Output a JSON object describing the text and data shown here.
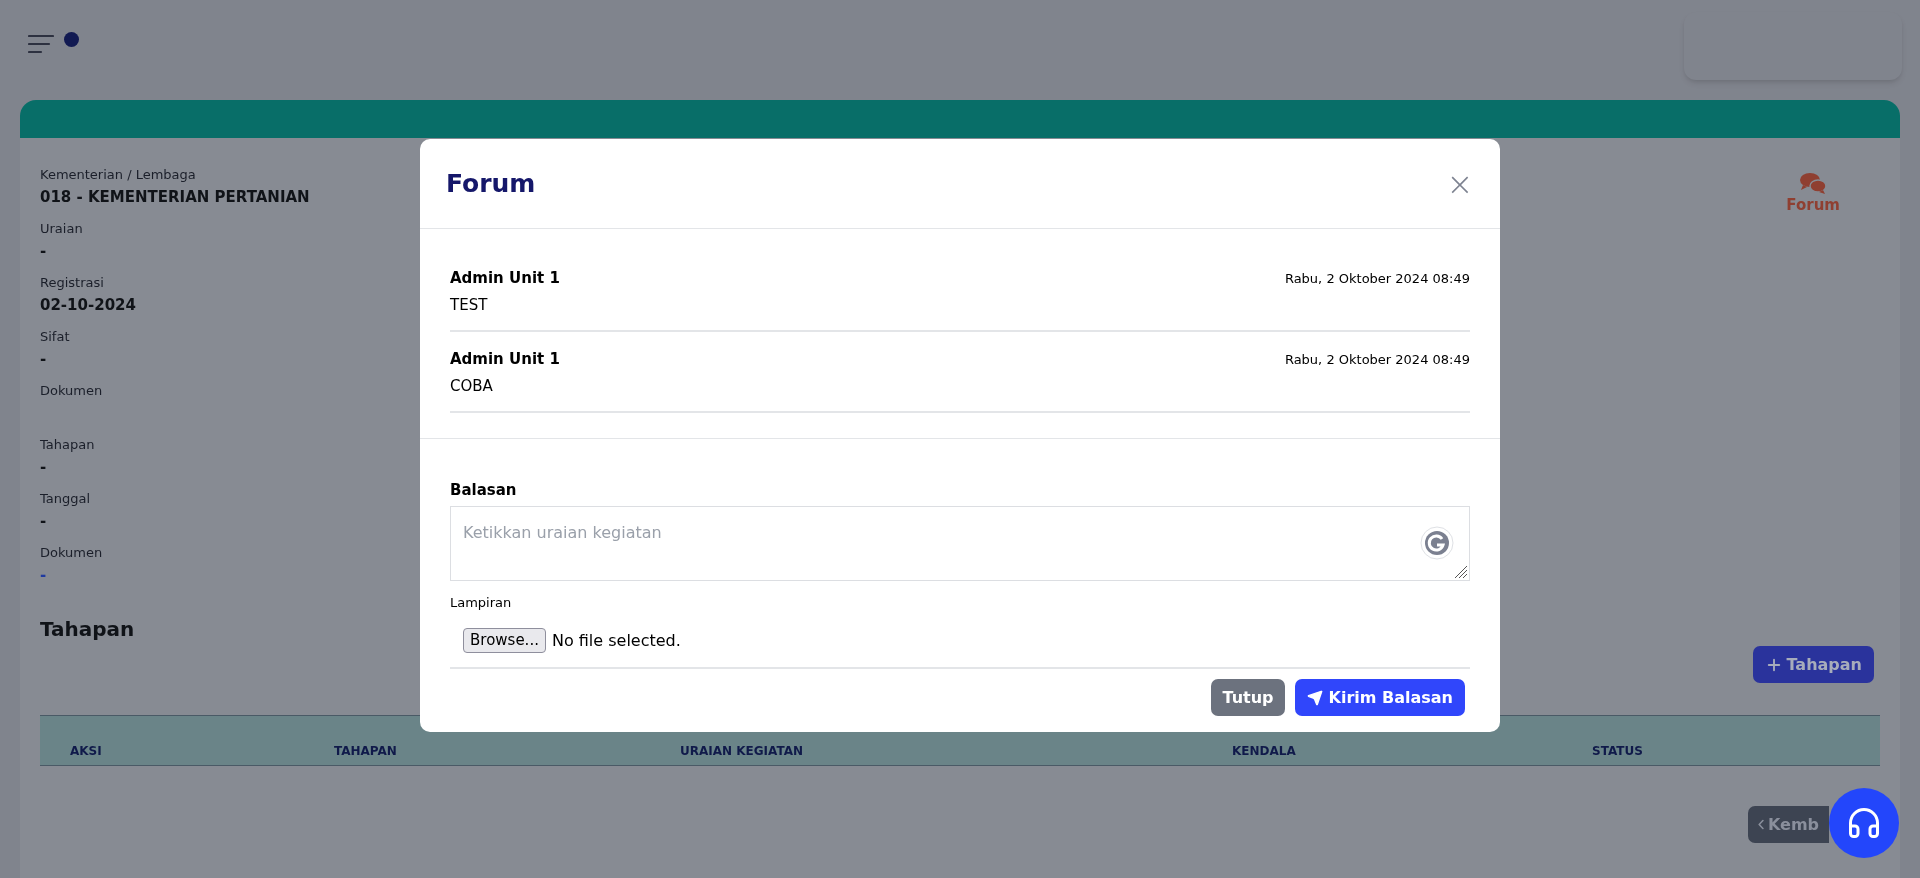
{
  "detail": {
    "fields": [
      {
        "label": "Kementerian / Lembaga",
        "value": "018 - KEMENTERIAN PERTANIAN",
        "kind": "bold"
      },
      {
        "label": "Uraian",
        "value": "-",
        "kind": "bold"
      },
      {
        "label": "Registrasi",
        "value": "02-10-2024",
        "kind": "bold"
      },
      {
        "label": "Sifat",
        "value": "-",
        "kind": "bold"
      },
      {
        "label": "Dokumen",
        "kind": "empty"
      },
      {
        "label": "Tahapan",
        "value": "-",
        "kind": "bold"
      },
      {
        "label": "Tanggal",
        "value": "-",
        "kind": "bold"
      },
      {
        "label": "Dokumen",
        "value": "-",
        "kind": "link"
      }
    ],
    "forum_link": "Forum"
  },
  "tahapan": {
    "title": "Tahapan",
    "add_button": "Tahapan",
    "columns": [
      "AKSI",
      "TAHAPAN",
      "URAIAN KEGIATAN",
      "KENDALA",
      "STATUS"
    ]
  },
  "back_button": "Kemb",
  "modal": {
    "title": "Forum",
    "close": "×",
    "messages": [
      {
        "author": "Admin Unit 1",
        "time": "Rabu, 2 Oktober 2024 08:49",
        "text": "TEST"
      },
      {
        "author": "Admin Unit 1",
        "time": "Rabu, 2 Oktober 2024 08:49",
        "text": "COBA"
      }
    ],
    "reply_label": "Balasan",
    "reply_placeholder": "Ketikkan uraian kegiatan",
    "attachment_label": "Lampiran",
    "browse_button": "Browse...",
    "file_status": "No file selected.",
    "buttons": [
      {
        "label": "Tutup",
        "kind": "secondary"
      },
      {
        "label": "Kirim Balasan",
        "kind": "primary"
      }
    ]
  }
}
